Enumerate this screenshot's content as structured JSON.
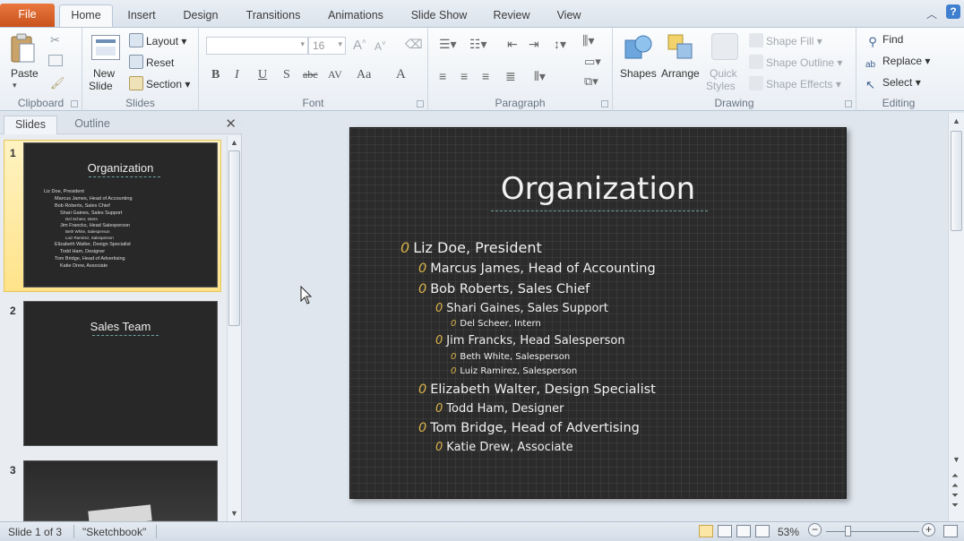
{
  "tabs": {
    "file": "File",
    "home": "Home",
    "insert": "Insert",
    "design": "Design",
    "transitions": "Transitions",
    "animations": "Animations",
    "slideshow": "Slide Show",
    "review": "Review",
    "view": "View"
  },
  "ribbon": {
    "clipboard": {
      "label": "Clipboard",
      "paste": "Paste"
    },
    "slides": {
      "label": "Slides",
      "new_slide_1": "New",
      "new_slide_2": "Slide",
      "layout": "Layout",
      "reset": "Reset",
      "section": "Section"
    },
    "font": {
      "label": "Font",
      "font_name": "",
      "font_size": "16",
      "bold": "B",
      "italic": "I",
      "underline": "U",
      "shadow": "S",
      "strike": "abc",
      "spacing": "AV",
      "case": "Aa",
      "color": "A"
    },
    "paragraph": {
      "label": "Paragraph"
    },
    "drawing": {
      "label": "Drawing",
      "shapes": "Shapes",
      "arrange": "Arrange",
      "quick_styles_1": "Quick",
      "quick_styles_2": "Styles",
      "shape_fill": "Shape Fill",
      "shape_outline": "Shape Outline",
      "shape_effects": "Shape Effects"
    },
    "editing": {
      "label": "Editing",
      "find": "Find",
      "replace": "Replace",
      "select": "Select"
    }
  },
  "pane": {
    "tab_slides": "Slides",
    "tab_outline": "Outline",
    "thumbnails": [
      {
        "num": "1",
        "title": "Organization",
        "lines": [
          "Liz Doe, President",
          "Marcus James, Head of Accounting",
          "Bob Roberts, Sales Chief",
          "Shari Gaines, Sales Support",
          "Del Scheer, Intern",
          "Jim Francks, Head Salesperson",
          "Beth White, Salesperson",
          "Luiz Ramirez, Salesperson",
          "Elizabeth Walter, Design Specialist",
          "Todd Ham, Designer",
          "Tom Bridge, Head of Advertising",
          "Katie Drew, Associate"
        ]
      },
      {
        "num": "2",
        "title": "Sales Team"
      },
      {
        "num": "3"
      }
    ]
  },
  "slide": {
    "title": "Organization",
    "bullets": [
      {
        "text": "Liz Doe, President",
        "level": 1
      },
      {
        "text": "Marcus James, Head of Accounting",
        "level": 2
      },
      {
        "text": "Bob Roberts, Sales Chief",
        "level": 2
      },
      {
        "text": "Shari Gaines, Sales Support",
        "level": 3
      },
      {
        "text": "Del Scheer, Intern",
        "level": 4
      },
      {
        "text": "Jim Francks, Head Salesperson",
        "level": 3
      },
      {
        "text": "Beth White, Salesperson",
        "level": 4
      },
      {
        "text": "Luiz Ramirez, Salesperson",
        "level": 4
      },
      {
        "text": "Elizabeth Walter, Design Specialist",
        "level": 2
      },
      {
        "text": "Todd Ham, Designer",
        "level": 3
      },
      {
        "text": "Tom Bridge, Head of Advertising",
        "level": 2
      },
      {
        "text": "Katie Drew, Associate",
        "level": 3
      }
    ],
    "bullet_glyph": "0"
  },
  "status": {
    "slide_of": "Slide 1 of 3",
    "theme": "\"Sketchbook\"",
    "zoom": "53%",
    "zoom_minus": "−",
    "zoom_plus": "+"
  },
  "colors": {
    "file_tab": "#d9622b",
    "slide_bg": "#2b2b2b",
    "bullet": "#d9b24a",
    "accent_underline": "#6ea3a0"
  }
}
